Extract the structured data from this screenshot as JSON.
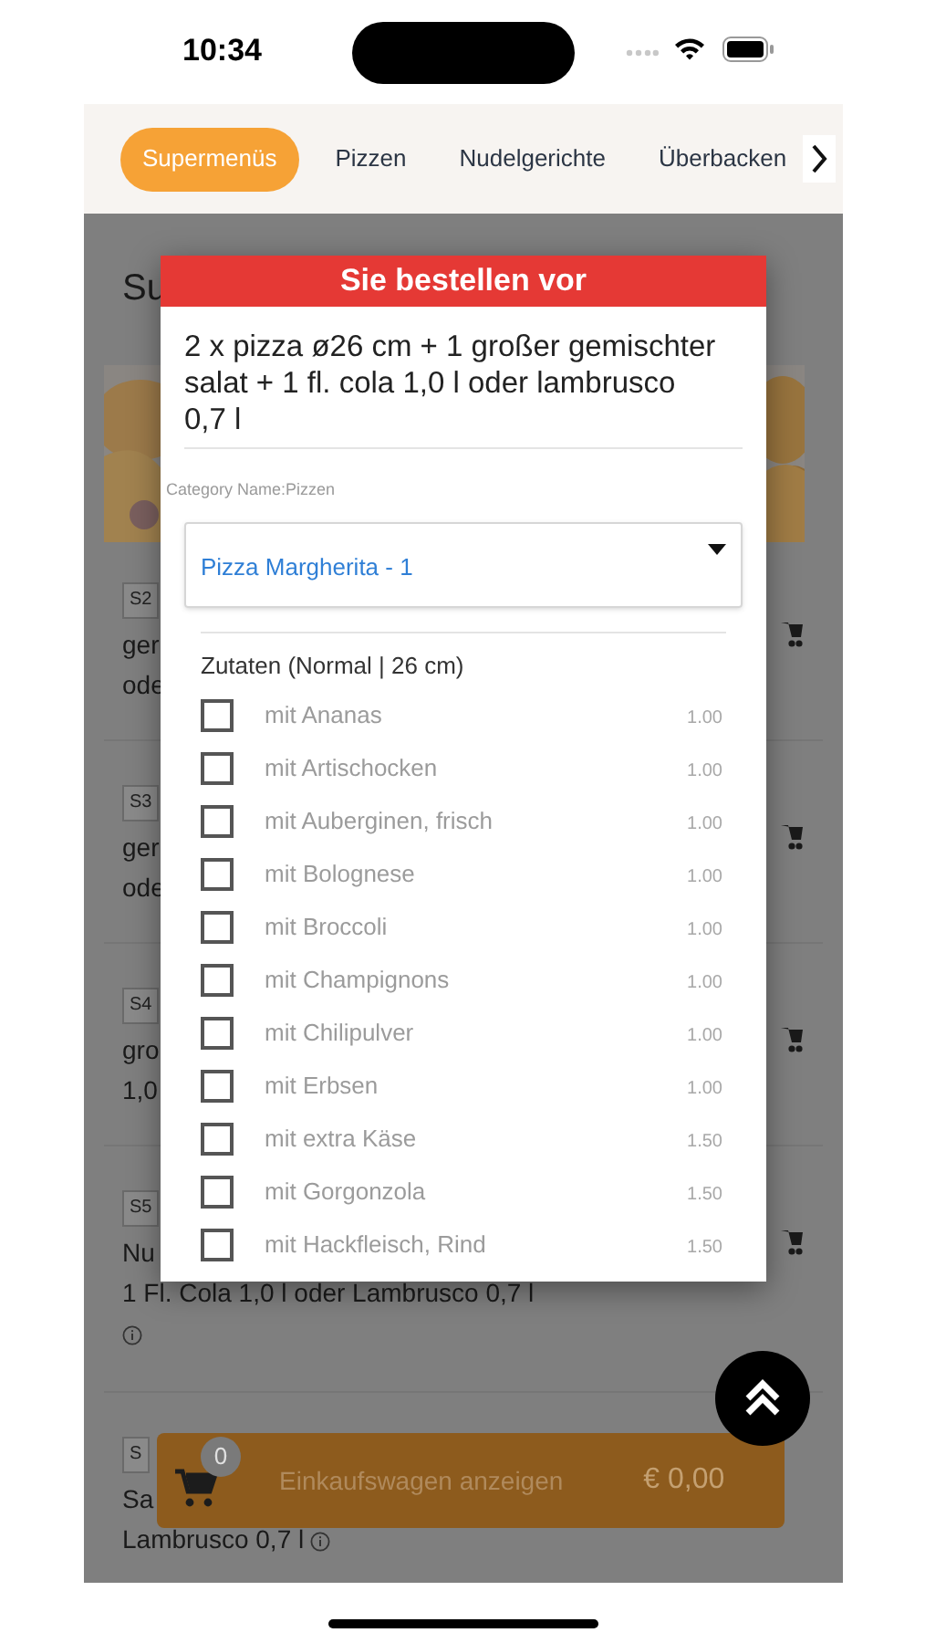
{
  "status_bar": {
    "time": "10:34"
  },
  "tabs": [
    {
      "label": "Supermenüs",
      "selected": true
    },
    {
      "label": "Pizzen",
      "selected": false
    },
    {
      "label": "Nudelgerichte",
      "selected": false
    },
    {
      "label": "Überbacken",
      "selected": false
    }
  ],
  "page_title": "Su",
  "menu_items": [
    {
      "code": "S2",
      "lines": [
        "ger",
        "ode"
      ],
      "cart_icon": true,
      "kind": "plain"
    },
    {
      "code": "S3",
      "lines": [
        "ger",
        "ode"
      ],
      "cart_icon": true,
      "kind": "plain"
    },
    {
      "code": "S4",
      "lines": [
        "gro",
        "1,0"
      ],
      "cart_icon": true,
      "kind": "plain"
    },
    {
      "code": "S5",
      "lines": [
        "Nu",
        "1 Fl. Cola 1,0 l oder Lambrusco 0,7 l"
      ],
      "cart_icon": true,
      "kind": "infoline"
    },
    {
      "code": "S",
      "lines": [
        "Sa",
        "Lambrusco 0,7 l"
      ],
      "cart_icon": false,
      "kind": "infoinline"
    }
  ],
  "modal": {
    "title": "Sie bestellen vor",
    "description": "2 x pizza ø26 cm + 1 großer gemischter salat + 1 fl. cola 1,0 l oder lambrusco 0,7 l",
    "category_label": "Category Name:Pizzen",
    "select": {
      "value": "Pizza Margherita - 1"
    },
    "section_title": "Zutaten (Normal | 26 cm)",
    "options": [
      {
        "label": "mit Ananas",
        "price": "1.00",
        "checked": false
      },
      {
        "label": "mit Artischocken",
        "price": "1.00",
        "checked": false
      },
      {
        "label": "mit Auberginen, frisch",
        "price": "1.00",
        "checked": false
      },
      {
        "label": "mit Bolognese",
        "price": "1.00",
        "checked": false
      },
      {
        "label": "mit Broccoli",
        "price": "1.00",
        "checked": false
      },
      {
        "label": "mit Champignons",
        "price": "1.00",
        "checked": false
      },
      {
        "label": "mit Chilipulver",
        "price": "1.00",
        "checked": false
      },
      {
        "label": "mit Erbsen",
        "price": "1.00",
        "checked": false
      },
      {
        "label": "mit extra Käse",
        "price": "1.50",
        "checked": false
      },
      {
        "label": "mit Gorgonzola",
        "price": "1.50",
        "checked": false
      },
      {
        "label": "mit Hackfleisch, Rind",
        "price": "1.50",
        "checked": false
      }
    ]
  },
  "cart_bar": {
    "count": "0",
    "label": "Einkaufswagen anzeigen",
    "total": "€ 0,00"
  }
}
